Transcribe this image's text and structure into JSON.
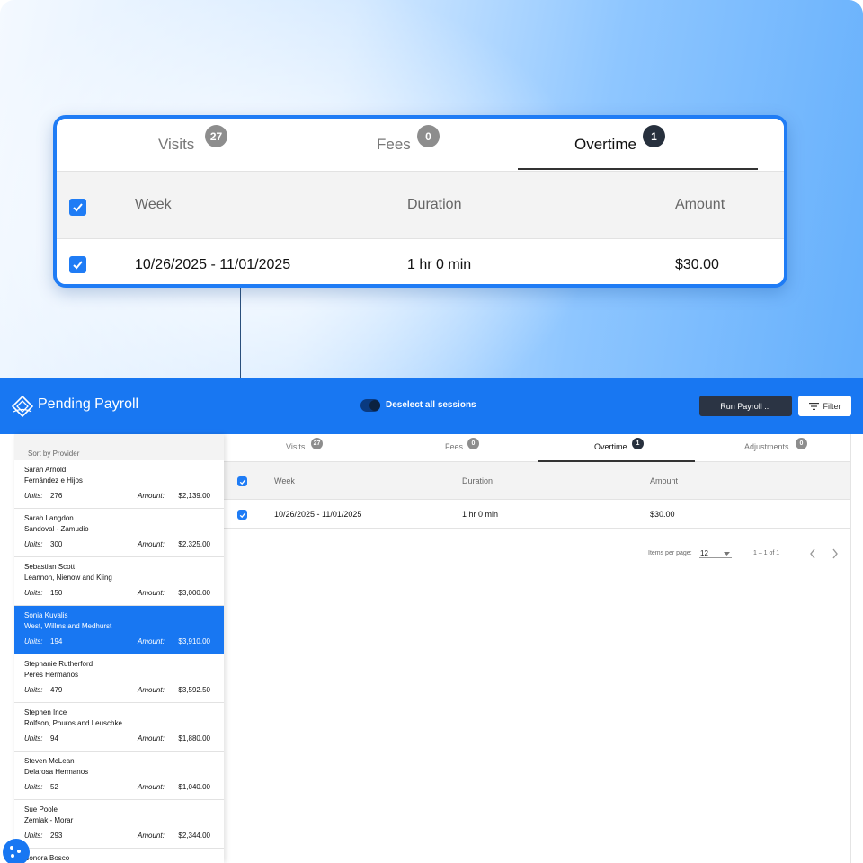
{
  "zoom_panel": {
    "tabs": [
      {
        "label": "Visits",
        "count": "27"
      },
      {
        "label": "Fees",
        "count": "0"
      },
      {
        "label": "Overtime",
        "count": "1"
      }
    ],
    "columns": {
      "week": "Week",
      "duration": "Duration",
      "amount": "Amount"
    },
    "row": {
      "week": "10/26/2025 - 11/01/2025",
      "duration": "1 hr 0 min",
      "amount": "$30.00"
    }
  },
  "header": {
    "title": "Pending Payroll",
    "toggle_label": "Deselect all sessions",
    "run_payroll": "Run Payroll ...",
    "filter": "Filter"
  },
  "sidebar": {
    "sort_label": "Sort by Provider",
    "units_label": "Units:",
    "amount_label": "Amount:",
    "items": [
      {
        "name": "Sarah Arnold",
        "company": "Fernández e Hijos",
        "units": "276",
        "amount": "$2,139.00"
      },
      {
        "name": "Sarah Langdon",
        "company": "Sandoval - Zamudio",
        "units": "300",
        "amount": "$2,325.00"
      },
      {
        "name": "Sebastian Scott",
        "company": "Leannon, Nienow and Kling",
        "units": "150",
        "amount": "$3,000.00"
      },
      {
        "name": "Sonia Kuvalis",
        "company": "West, Willms and Medhurst",
        "units": "194",
        "amount": "$3,910.00"
      },
      {
        "name": "Stephanie Rutherford",
        "company": "Peres Hermanos",
        "units": "479",
        "amount": "$3,592.50"
      },
      {
        "name": "Stephen Ince",
        "company": "Rolfson, Pouros and Leuschke",
        "units": "94",
        "amount": "$1,880.00"
      },
      {
        "name": "Steven McLean",
        "company": "Delarosa Hermanos",
        "units": "52",
        "amount": "$1,040.00"
      },
      {
        "name": "Sue Poole",
        "company": "Zemlak - Morar",
        "units": "293",
        "amount": "$2,344.00"
      },
      {
        "name": "Sonora Bosco",
        "company": "",
        "units": "",
        "amount": ""
      }
    ],
    "selected_index": 3
  },
  "main": {
    "tabs": [
      {
        "label": "Visits",
        "count": "27"
      },
      {
        "label": "Fees",
        "count": "0"
      },
      {
        "label": "Overtime",
        "count": "1"
      },
      {
        "label": "Adjustments",
        "count": "0"
      }
    ],
    "columns": {
      "week": "Week",
      "duration": "Duration",
      "amount": "Amount"
    },
    "row": {
      "week": "10/26/2025 - 11/01/2025",
      "duration": "1 hr 0 min",
      "amount": "$30.00"
    },
    "paginator": {
      "items_per_page_label": "Items per page:",
      "items_per_page": "12",
      "range": "1 – 1 of 1"
    }
  },
  "colors": {
    "accent": "#1877f2",
    "dark_button": "#2b3444",
    "badge_active": "#27303d",
    "badge": "#8d8d8d"
  },
  "icons": {
    "logo": "logo-icon",
    "filter": "filter-icon",
    "prev": "chevron-left-icon",
    "next": "chevron-right-icon",
    "cookie": "cookie-icon"
  }
}
